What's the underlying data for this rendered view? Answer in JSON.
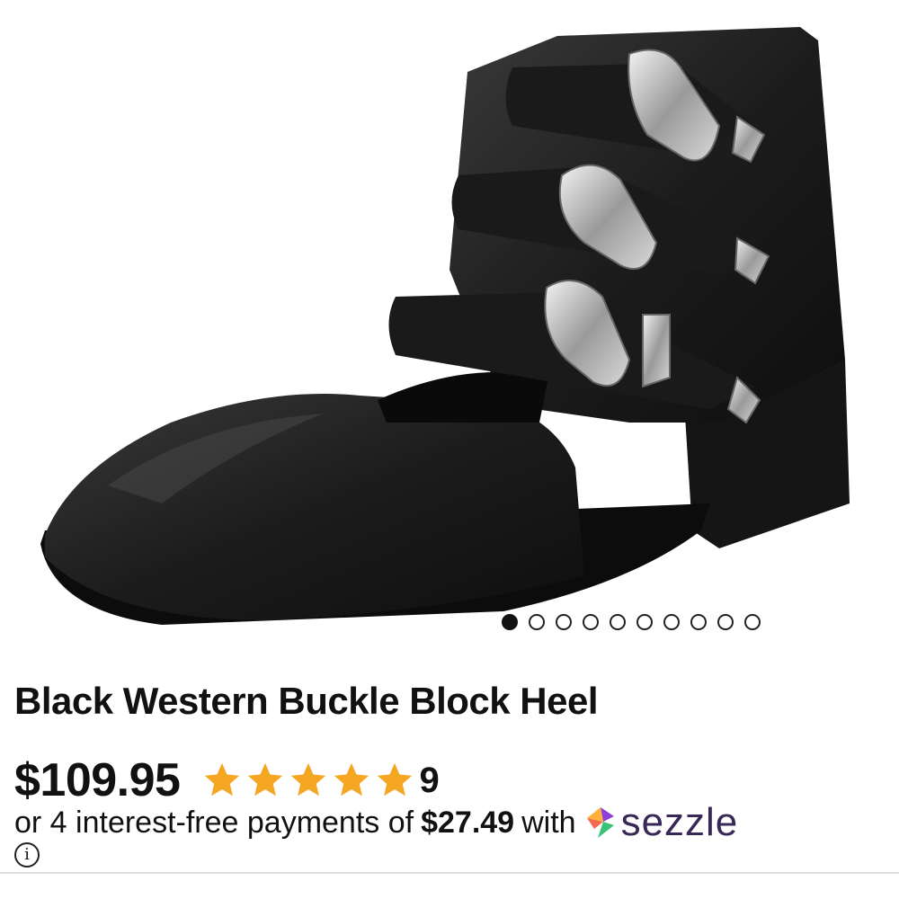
{
  "product": {
    "image_alt": "Black western buckle ankle boot with three silver buckle straps",
    "title": "Black Western Buckle Block Heel",
    "price": "$109.95",
    "rating": 5,
    "rating_max": 5,
    "review_count": "9"
  },
  "carousel": {
    "total": 10,
    "active_index": 0
  },
  "payment": {
    "prefix": "or 4 interest-free payments of",
    "installment": "$27.49",
    "suffix": "with",
    "provider": "sezzle"
  },
  "info_icon": "info-icon",
  "colors": {
    "star": "#F5A623",
    "sezzle_text": "#382757",
    "text": "#111111"
  }
}
